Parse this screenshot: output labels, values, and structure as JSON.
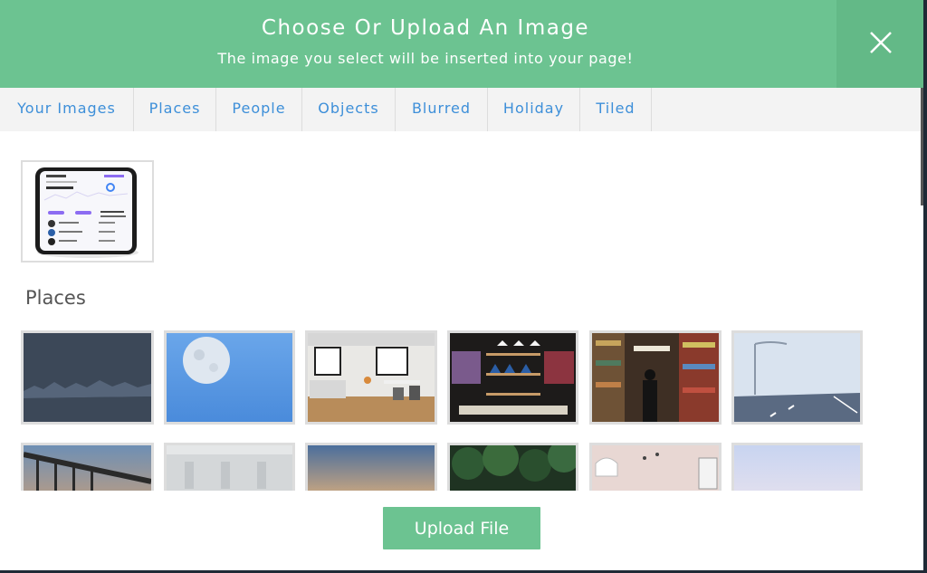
{
  "header": {
    "title": "Choose Or Upload An Image",
    "subtitle": "The image you select will be inserted into your page!"
  },
  "close_icon": "close-icon",
  "tabs": [
    "Your Images",
    "Places",
    "People",
    "Objects",
    "Blurred",
    "Holiday",
    "Tiled"
  ],
  "your_images": [
    {
      "name": "portfolio-phone-screenshot"
    }
  ],
  "places": {
    "heading": "Places",
    "rows": [
      [
        "mountain-silhouette",
        "moon-sky",
        "office-interior",
        "clothing-store",
        "library-aisles",
        "foggy-highway"
      ],
      [
        "pier-sunset",
        "misty-building",
        "sunset-sky",
        "forest-trees",
        "pink-wall-window",
        "pastel-sky"
      ]
    ]
  },
  "upload": {
    "label": "Upload File"
  },
  "colors": {
    "header": "#6cc391",
    "tab_text": "#3d8fd9"
  }
}
